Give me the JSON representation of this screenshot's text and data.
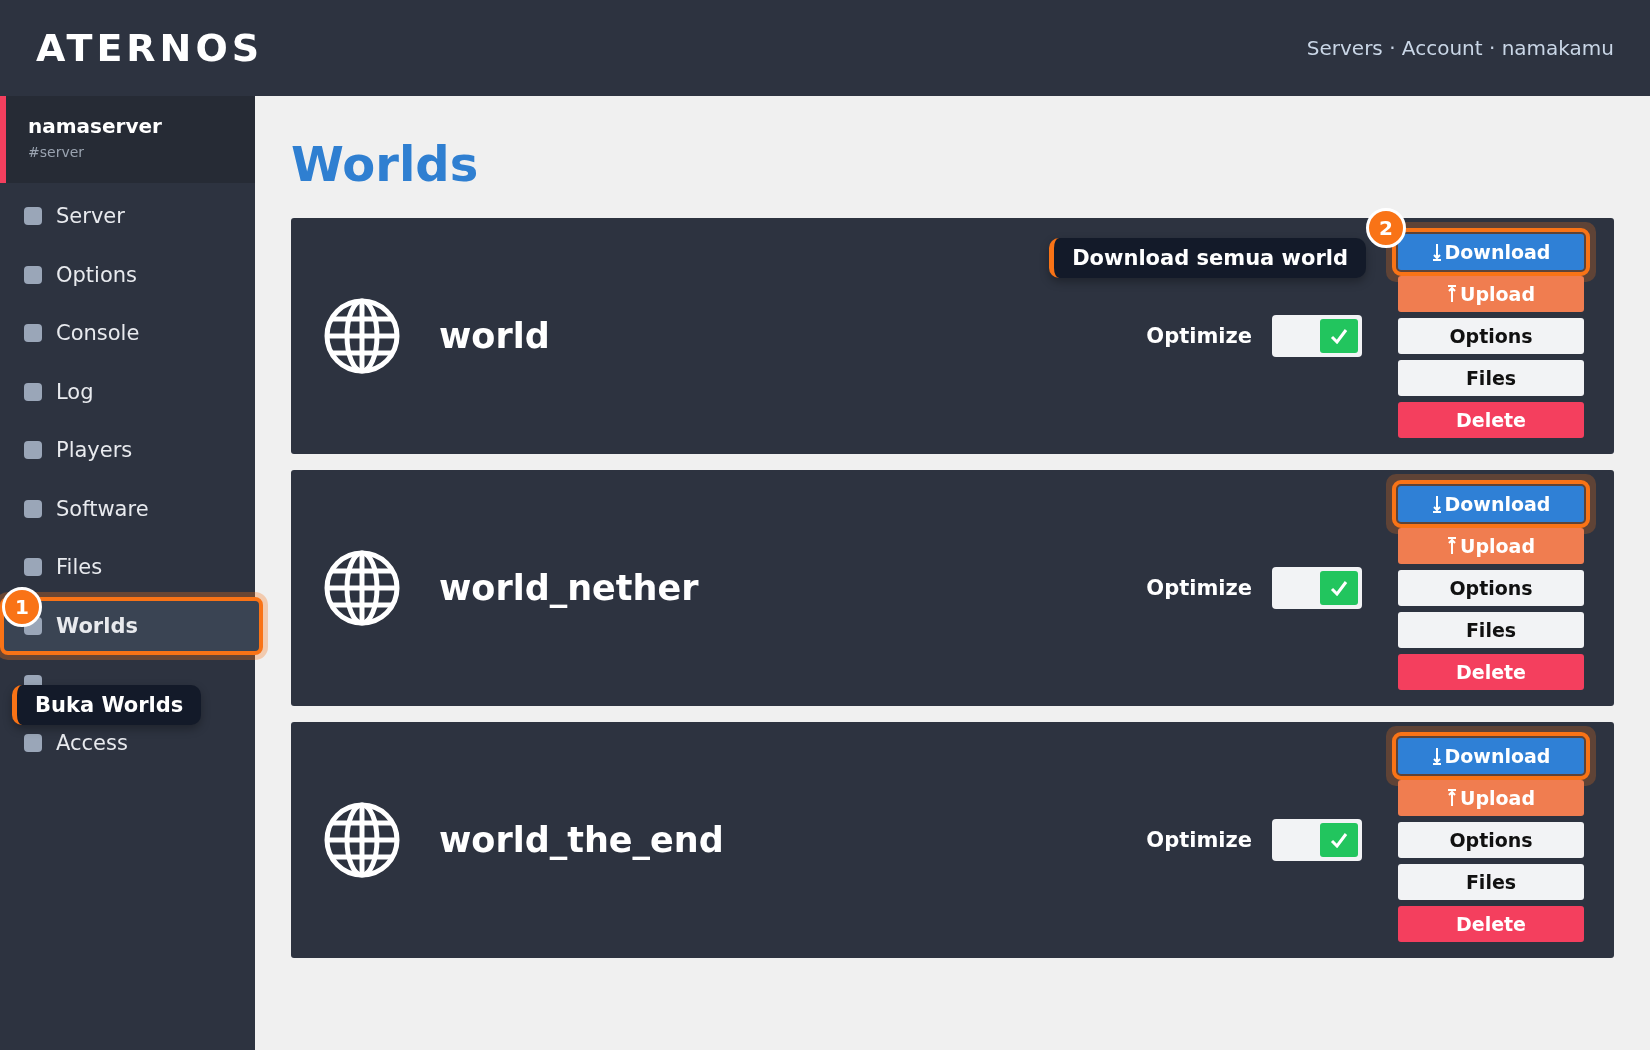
{
  "header": {
    "logo": "ATERNOS",
    "nav": "Servers · Account · namakamu"
  },
  "sidebar": {
    "server_name": "namaserver",
    "server_address": "#server",
    "items": [
      {
        "label": "Server",
        "selected": false,
        "highlighted": false
      },
      {
        "label": "Options",
        "selected": false,
        "highlighted": false
      },
      {
        "label": "Console",
        "selected": false,
        "highlighted": false
      },
      {
        "label": "Log",
        "selected": false,
        "highlighted": false
      },
      {
        "label": "Players",
        "selected": false,
        "highlighted": false
      },
      {
        "label": "Software",
        "selected": false,
        "highlighted": false
      },
      {
        "label": "Files",
        "selected": false,
        "highlighted": false
      },
      {
        "label": "Worlds",
        "selected": true,
        "highlighted": true,
        "step": "1",
        "tooltip": "Buka Worlds"
      },
      {
        "selected": false,
        "highlighted": false
      },
      {
        "label": "Access",
        "selected": false,
        "highlighted": false
      }
    ]
  },
  "page_title": "Worlds",
  "worlds": [
    {
      "name": "world",
      "optimize_label": "Optimize",
      "optimize_on": true,
      "tooltip": "Download semua world",
      "step": "2",
      "buttons": [
        {
          "kind": "download",
          "label": "Download",
          "highlighted": true
        },
        {
          "kind": "upload",
          "label": "Upload",
          "highlighted": false
        },
        {
          "kind": "plain",
          "label": "Options",
          "highlighted": false
        },
        {
          "kind": "plain",
          "label": "Files",
          "highlighted": false
        },
        {
          "kind": "delete",
          "label": "Delete",
          "highlighted": false
        }
      ]
    },
    {
      "name": "world_nether",
      "optimize_label": "Optimize",
      "optimize_on": true,
      "buttons": [
        {
          "kind": "download",
          "label": "Download",
          "highlighted": true
        },
        {
          "kind": "upload",
          "label": "Upload",
          "highlighted": false
        },
        {
          "kind": "plain",
          "label": "Options",
          "highlighted": false
        },
        {
          "kind": "plain",
          "label": "Files",
          "highlighted": false
        },
        {
          "kind": "delete",
          "label": "Delete",
          "highlighted": false
        }
      ]
    },
    {
      "name": "world_the_end",
      "optimize_label": "Optimize",
      "optimize_on": true,
      "buttons": [
        {
          "kind": "download",
          "label": "Download",
          "highlighted": true
        },
        {
          "kind": "upload",
          "label": "Upload",
          "highlighted": false
        },
        {
          "kind": "plain",
          "label": "Options",
          "highlighted": false
        },
        {
          "kind": "plain",
          "label": "Files",
          "highlighted": false
        },
        {
          "kind": "delete",
          "label": "Delete",
          "highlighted": false
        }
      ]
    }
  ]
}
